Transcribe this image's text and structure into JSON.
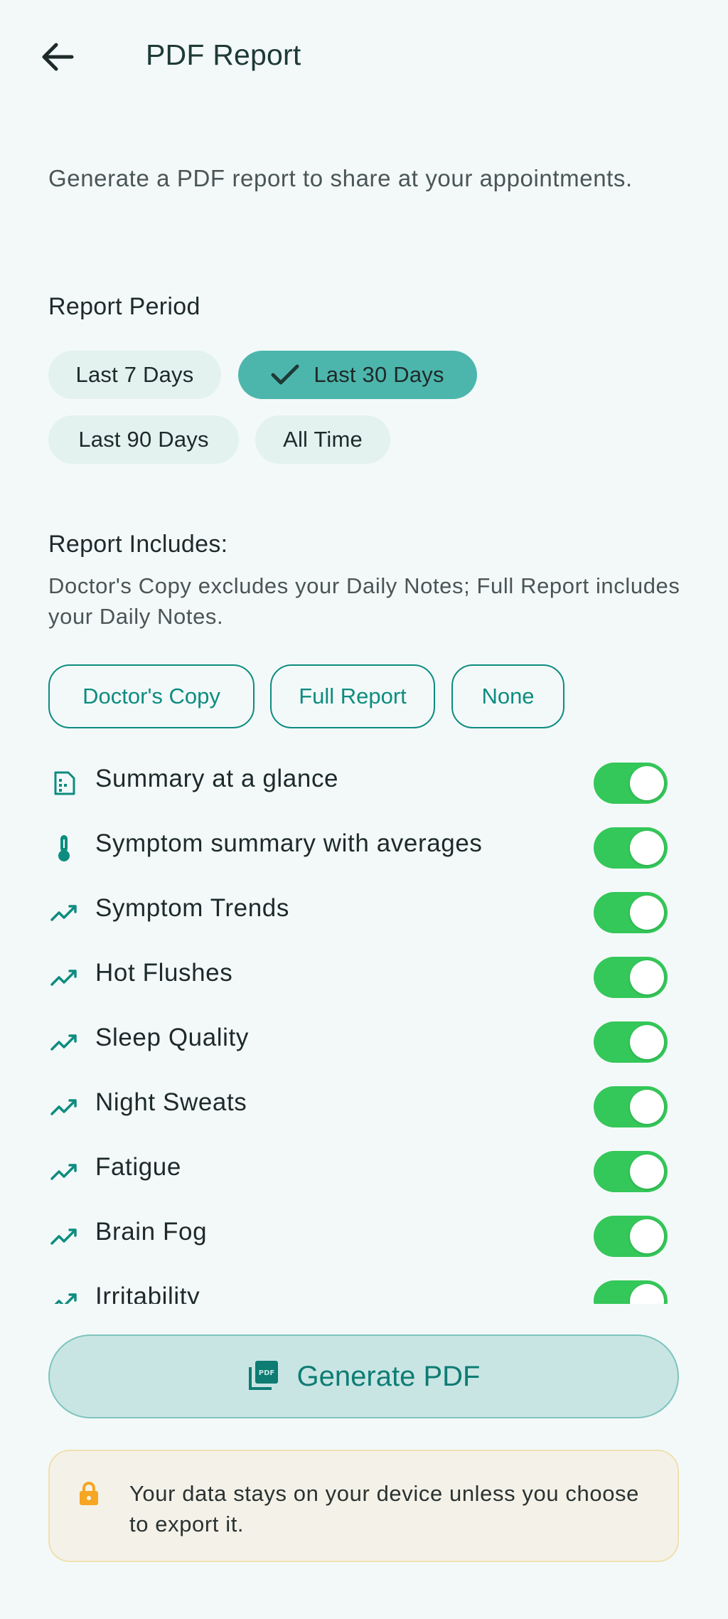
{
  "header": {
    "title": "PDF Report",
    "back_icon": "arrow-back-icon"
  },
  "intro": "Generate a PDF report to share at your appointments.",
  "period": {
    "title": "Report Period",
    "options": [
      {
        "label": "Last 7 Days",
        "selected": false
      },
      {
        "label": "Last 30 Days",
        "selected": true
      },
      {
        "label": "Last 90 Days",
        "selected": false
      },
      {
        "label": "All Time",
        "selected": false
      }
    ]
  },
  "includes": {
    "title": "Report Includes:",
    "description": "Doctor's Copy excludes your Daily Notes; Full Report includes your Daily Notes.",
    "presets": [
      "Doctor's Copy",
      "Full Report",
      "None"
    ],
    "items": [
      {
        "label": "Summary at a glance",
        "icon": "summary-icon",
        "on": true
      },
      {
        "label": "Symptom summary with averages",
        "icon": "thermometer-icon",
        "on": true
      },
      {
        "label": "Symptom Trends",
        "icon": "trend-icon",
        "on": true
      },
      {
        "label": "Hot Flushes",
        "icon": "trend-icon",
        "on": true
      },
      {
        "label": "Sleep Quality",
        "icon": "trend-icon",
        "on": true
      },
      {
        "label": "Night Sweats",
        "icon": "trend-icon",
        "on": true
      },
      {
        "label": "Fatigue",
        "icon": "trend-icon",
        "on": true
      },
      {
        "label": "Brain Fog",
        "icon": "trend-icon",
        "on": true
      },
      {
        "label": "Irritability",
        "icon": "trend-icon",
        "on": true
      }
    ]
  },
  "generate": {
    "label": "Generate PDF",
    "icon": "pdf-file-icon"
  },
  "notice": {
    "text": "Your data stays on your device unless you choose to export it.",
    "icon": "lock-icon"
  },
  "colors": {
    "accent": "#0E8C80",
    "chip_selected": "#4DB6AC",
    "toggle_on": "#34C759",
    "lock": "#F5A623"
  }
}
